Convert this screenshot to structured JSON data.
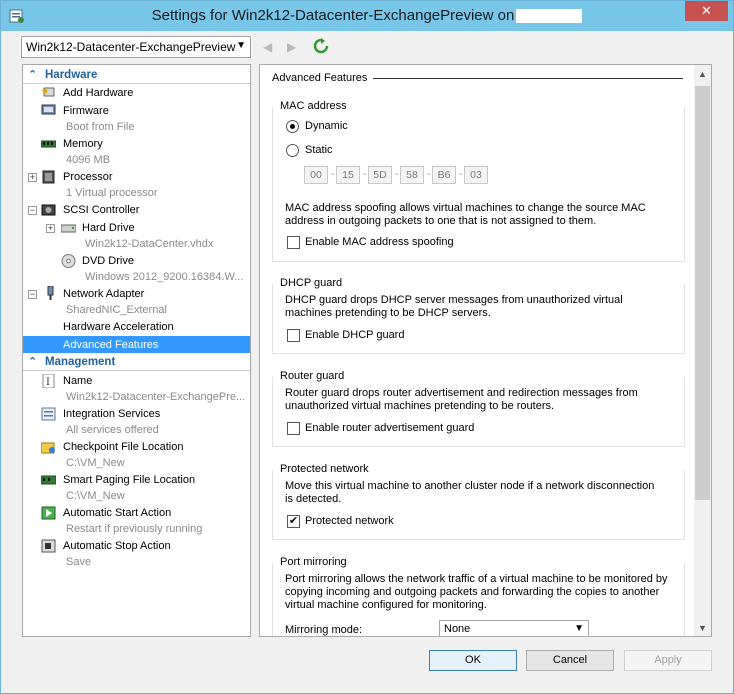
{
  "window": {
    "title": "Settings for Win2k12-Datacenter-ExchangePreview on",
    "close_glyph": "✕"
  },
  "toolbar": {
    "vm_select_value": "Win2k12-Datacenter-ExchangePreview",
    "back_glyph": "◀",
    "forward_glyph": "▶"
  },
  "tree": {
    "hardware_header": "Hardware",
    "management_header": "Management",
    "hardware_items": [
      {
        "label": "Add Hardware",
        "sub": ""
      },
      {
        "label": "Firmware",
        "sub": "Boot from File"
      },
      {
        "label": "Memory",
        "sub": "4096 MB"
      },
      {
        "label": "Processor",
        "sub": "1 Virtual processor"
      },
      {
        "label": "SCSI Controller",
        "sub": ""
      },
      {
        "label": "Hard Drive",
        "sub": "Win2k12-DataCenter.vhdx"
      },
      {
        "label": "DVD Drive",
        "sub": "Windows 2012_9200.16384.W..."
      },
      {
        "label": "Network Adapter",
        "sub": "SharedNIC_External"
      },
      {
        "label": "Hardware Acceleration",
        "sub": ""
      },
      {
        "label": "Advanced Features",
        "sub": ""
      }
    ],
    "management_items": [
      {
        "label": "Name",
        "sub": "Win2k12-Datacenter-ExchangePre..."
      },
      {
        "label": "Integration Services",
        "sub": "All services offered"
      },
      {
        "label": "Checkpoint File Location",
        "sub": "C:\\VM_New"
      },
      {
        "label": "Smart Paging File Location",
        "sub": "C:\\VM_New"
      },
      {
        "label": "Automatic Start Action",
        "sub": "Restart if previously running"
      },
      {
        "label": "Automatic Stop Action",
        "sub": "Save"
      }
    ]
  },
  "panel": {
    "title": "Advanced Features",
    "mac": {
      "group_label": "MAC address",
      "dynamic_label": "Dynamic",
      "static_label": "Static",
      "selected": "Dynamic",
      "octets": [
        "00",
        "15",
        "5D",
        "58",
        "B6",
        "03"
      ],
      "spoof_desc": "MAC address spoofing allows virtual machines to change the source MAC address in outgoing packets to one that is not assigned to them.",
      "spoof_label": "Enable MAC address spoofing",
      "spoof_checked": false
    },
    "dhcp": {
      "group_label": "DHCP guard",
      "desc": "DHCP guard drops DHCP server messages from unauthorized virtual machines pretending to be DHCP servers.",
      "check_label": "Enable DHCP guard",
      "checked": false
    },
    "router": {
      "group_label": "Router guard",
      "desc": "Router guard drops router advertisement and redirection messages from unauthorized virtual machines pretending to be routers.",
      "check_label": "Enable router advertisement guard",
      "checked": false
    },
    "protected": {
      "group_label": "Protected network",
      "desc": "Move this virtual machine to another cluster node if a network disconnection is detected.",
      "check_label": "Protected network",
      "checked": true,
      "check_glyph": "✔"
    },
    "mirroring": {
      "group_label": "Port mirroring",
      "desc": "Port mirroring allows the network traffic of a virtual machine to be monitored by copying incoming and outgoing packets and forwarding the copies to another virtual machine configured for monitoring.",
      "mode_label": "Mirroring mode:",
      "mode_value": "None"
    }
  },
  "buttons": {
    "ok": "OK",
    "cancel": "Cancel",
    "apply": "Apply"
  },
  "colors": {
    "titlebar": "#78c6e8",
    "selection": "#3399ff",
    "section_header": "#1e5f9e",
    "close": "#c75050"
  }
}
